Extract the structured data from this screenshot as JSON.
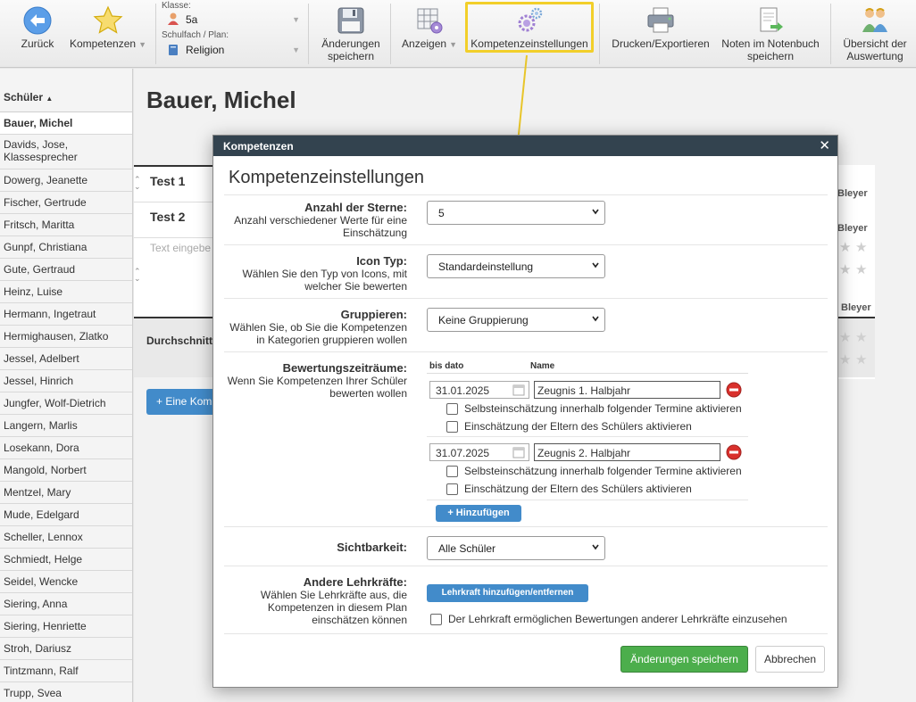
{
  "toolbar": {
    "back_label": "Zurück",
    "kompetenzen_label": "Kompetenzen",
    "klasse_label": "Klasse:",
    "klasse_value": "5a",
    "schulfach_label": "Schulfach / Plan:",
    "schulfach_value": "Religion",
    "save_changes_line1": "Änderungen",
    "save_changes_line2": "speichern",
    "anzeigen_label": "Anzeigen",
    "kompetenzeinstellungen_label": "Kompetenzeinstellungen",
    "print_label": "Drucken/Exportieren",
    "noten_line1": "Noten im Notenbuch",
    "noten_line2": "speichern",
    "uebersicht_line1": "Übersicht der",
    "uebersicht_line2": "Auswertung"
  },
  "sidebar": {
    "header": "Schüler",
    "students": [
      "Bauer, Michel",
      "Davids, Jose, Klassesprecher",
      "Dowerg, Jeanette",
      "Fischer, Gertrude",
      "Fritsch, Maritta",
      "Gunpf, Christiana",
      "Gute, Gertraud",
      "Heinz, Luise",
      "Hermann, Ingetraut",
      "Hermighausen, Zlatko",
      "Jessel, Adelbert",
      "Jessel, Hinrich",
      "Jungfer, Wolf-Dietrich",
      "Langern, Marlis",
      "Losekann, Dora",
      "Mangold, Norbert",
      "Mentzel, Mary",
      "Mude, Edelgard",
      "Scheller, Lennox",
      "Schmiedt, Helge",
      "Seidel, Wencke",
      "Siering, Anna",
      "Siering, Henriette",
      "Stroh, Dariusz",
      "Tintzmann, Ralf",
      "Trupp, Svea"
    ]
  },
  "main": {
    "student_name": "Bauer, Michel",
    "row1": "Test 1",
    "row2": "Test 2",
    "text_placeholder": "Text eingebe",
    "durchschnitt": "Durchschnitt",
    "add_button": "+ Eine Kom",
    "bleyer": "Bleyer",
    "bleyer_partial": "Bleyer"
  },
  "modal": {
    "header": "Kompetenzen",
    "title": "Kompetenzeinstellungen",
    "stars": {
      "label": "Anzahl der Sterne:",
      "desc": "Anzahl verschiedener Werte für eine Einschätzung",
      "value": "5"
    },
    "icon_type": {
      "label": "Icon Typ:",
      "desc": "Wählen Sie den Typ von Icons, mit welcher Sie bewerten",
      "value": "Standardeinstellung"
    },
    "group": {
      "label": "Gruppieren:",
      "desc": "Wählen Sie, ob Sie die Kompetenzen in Kategorien gruppieren wollen",
      "value": "Keine Gruppierung"
    },
    "periods": {
      "label": "Bewertungszeiträume:",
      "desc": "Wenn Sie Kompetenzen Ihrer Schüler bewerten wollen",
      "col_date": "bis dato",
      "col_name": "Name",
      "items": [
        {
          "date": "31.01.2025",
          "name": "Zeugnis 1. Halbjahr",
          "self": "Selbsteinschätzung innerhalb folgender Termine aktivieren",
          "parents": "Einschätzung der Eltern des Schülers aktivieren"
        },
        {
          "date": "31.07.2025",
          "name": "Zeugnis 2. Halbjahr",
          "self": "Selbsteinschätzung innerhalb folgender Termine aktivieren",
          "parents": "Einschätzung der Eltern des Schülers aktivieren"
        }
      ],
      "add_button": "+ Hinzufügen"
    },
    "visibility": {
      "label": "Sichtbarkeit:",
      "value": "Alle Schüler"
    },
    "teachers": {
      "label": "Andere Lehrkräfte:",
      "desc": "Wählen Sie Lehrkräfte aus, die Kompetenzen in diesem Plan einschätzen können",
      "button": "Lehrkraft hinzufügen/entfernen",
      "checkbox": "Der Lehrkraft ermöglichen Bewertungen anderer Lehrkräfte einzusehen"
    },
    "save_button": "Änderungen speichern",
    "cancel_button": "Abbrechen"
  },
  "colors": {
    "toolbar_highlight": "#f2cf2a",
    "modal_header": "#33434f",
    "primary_blue": "#428bca",
    "success_green": "#4cae4c"
  }
}
